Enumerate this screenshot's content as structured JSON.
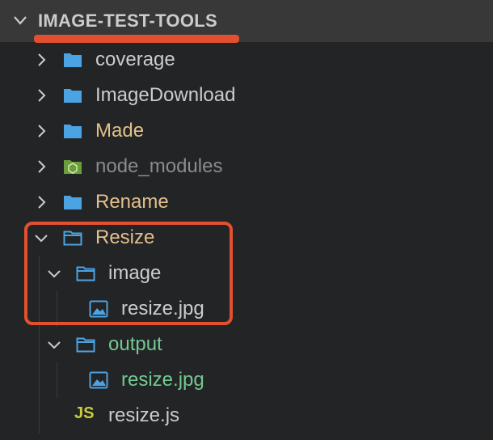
{
  "explorer": {
    "root_title": "IMAGE-TEST-TOOLS",
    "items": [
      {
        "label": "coverage",
        "type": "folder",
        "expanded": false,
        "color": "#cccccc"
      },
      {
        "label": "ImageDownload",
        "type": "folder",
        "expanded": false,
        "color": "#cccccc"
      },
      {
        "label": "Made",
        "type": "folder",
        "expanded": false,
        "color": "#e2c08d"
      },
      {
        "label": "node_modules",
        "type": "node-folder",
        "expanded": false,
        "color": "#8b8b8b"
      },
      {
        "label": "Rename",
        "type": "folder",
        "expanded": false,
        "color": "#e2c08d"
      },
      {
        "label": "Resize",
        "type": "folder",
        "expanded": true,
        "color": "#e2c08d"
      },
      {
        "label": "image",
        "type": "folder",
        "expanded": true,
        "color": "#cccccc"
      },
      {
        "label": "resize.jpg",
        "type": "image-file",
        "color": "#cccccc"
      },
      {
        "label": "output",
        "type": "folder",
        "expanded": true,
        "color": "#73c991"
      },
      {
        "label": "resize.jpg",
        "type": "image-file",
        "color": "#73c991"
      },
      {
        "label": "resize.js",
        "type": "js-file",
        "color": "#cccccc",
        "icon_text": "JS"
      }
    ]
  },
  "colors": {
    "folder_icon": "#4ba3e3",
    "annotation": "#e2502f",
    "node_icon": "#8bc34a"
  }
}
